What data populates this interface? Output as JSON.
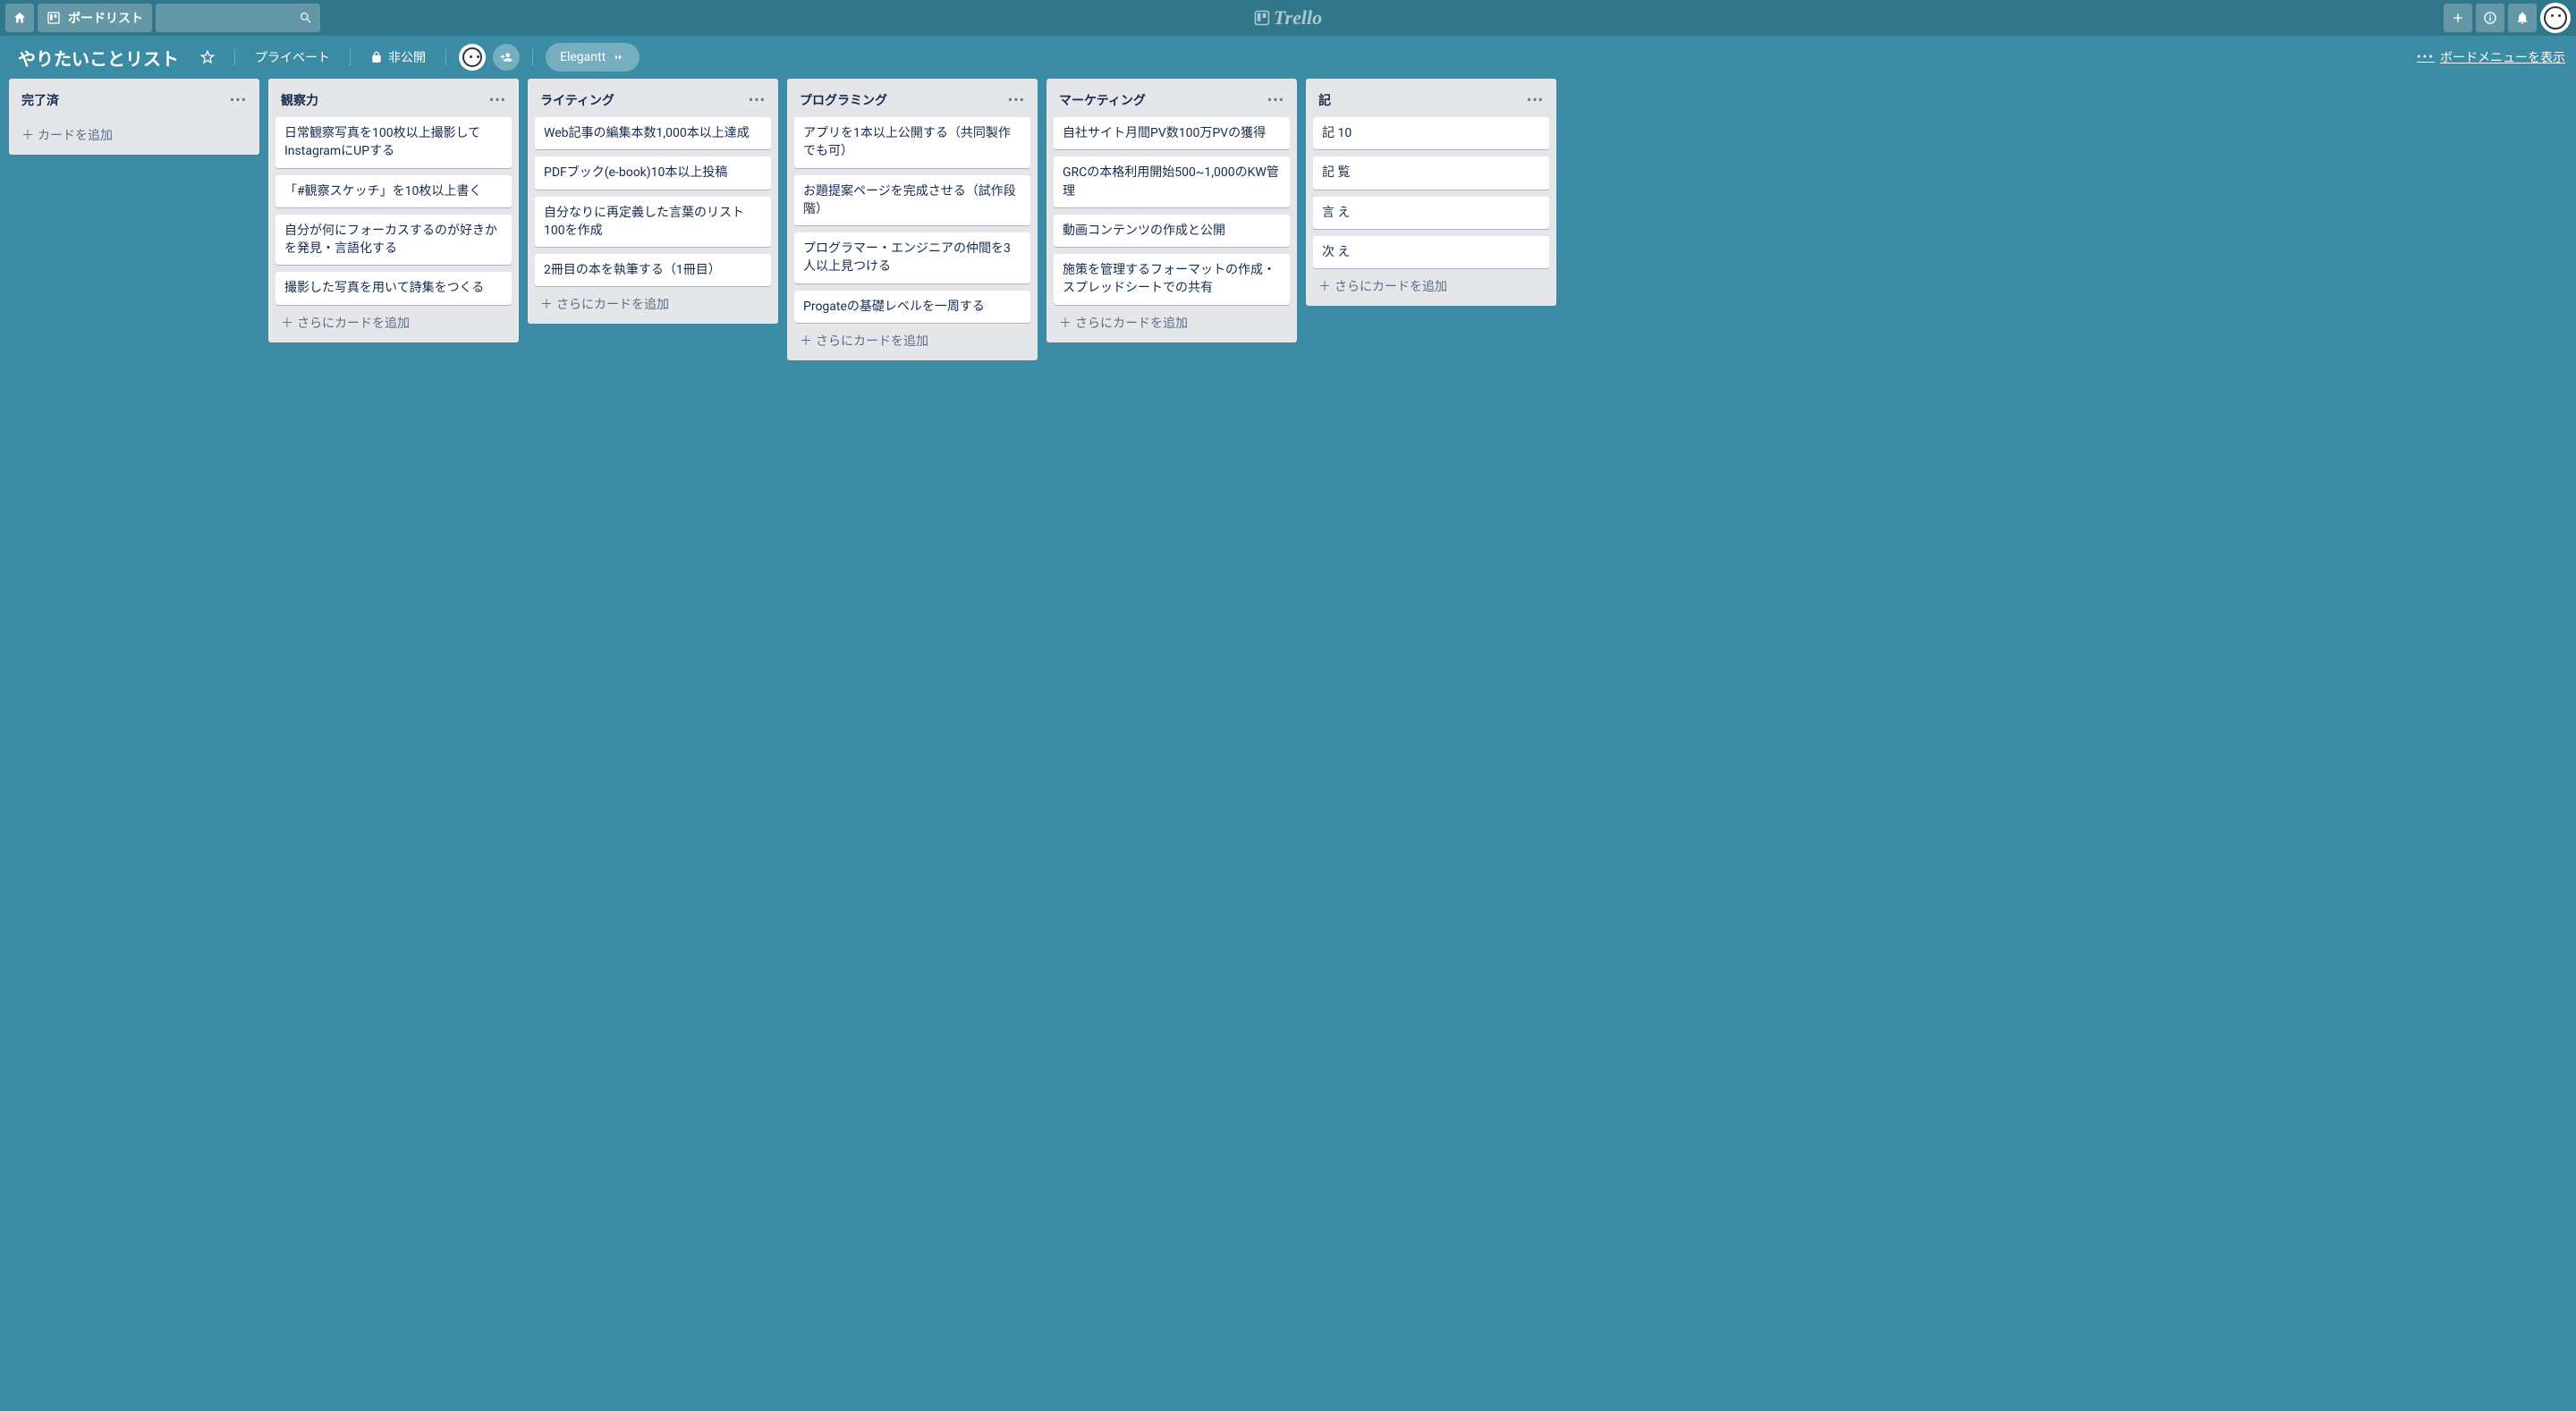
{
  "header": {
    "boards_button": "ボードリスト",
    "logo_text": "Trello"
  },
  "board_header": {
    "name": "やりたいことリスト",
    "private_label": "プライベート",
    "visibility_label": "非公開",
    "elegantt_label": "Elegantt",
    "show_menu_label": "ボードメニューを表示"
  },
  "add_card_label": "カードを追加",
  "add_more_card_label": "さらにカードを追加",
  "lists": [
    {
      "title": "完了済",
      "cards": [],
      "add_label_key": "add_card_label"
    },
    {
      "title": "観察力",
      "cards": [
        "日常観察写真を100枚以上撮影してInstagramにUPする",
        "「#観察スケッチ」を10枚以上書く",
        "自分が何にフォーカスするのが好きかを発見・言語化する",
        "撮影した写真を用いて詩集をつくる"
      ],
      "add_label_key": "add_more_card_label"
    },
    {
      "title": "ライティング",
      "cards": [
        "Web記事の編集本数1,000本以上達成",
        "PDFブック(e-book)10本以上投稿",
        "自分なりに再定義した言葉のリスト100を作成",
        "2冊目の本を執筆する（1冊目）"
      ],
      "add_label_key": "add_more_card_label"
    },
    {
      "title": "プログラミング",
      "cards": [
        "アプリを1本以上公開する（共同製作でも可）",
        "お題提案ページを完成させる（試作段階）",
        "プログラマー・エンジニアの仲間を3人以上見つける",
        "Progateの基礎レベルを一周する"
      ],
      "add_label_key": "add_more_card_label"
    },
    {
      "title": "マーケティング",
      "cards": [
        "自社サイト月間PV数100万PVの獲得",
        "GRCの本格利用開始500~1,000のKW管理",
        "動画コンテンツの作成と公開",
        "施策を管理するフォーマットの作成・スプレッドシートでの共有"
      ],
      "add_label_key": "add_more_card_label"
    },
    {
      "title": "記",
      "cards": [
        "記 10",
        "記 覧",
        "言 え",
        "次 え"
      ],
      "add_label_key": "add_more_card_label"
    }
  ]
}
